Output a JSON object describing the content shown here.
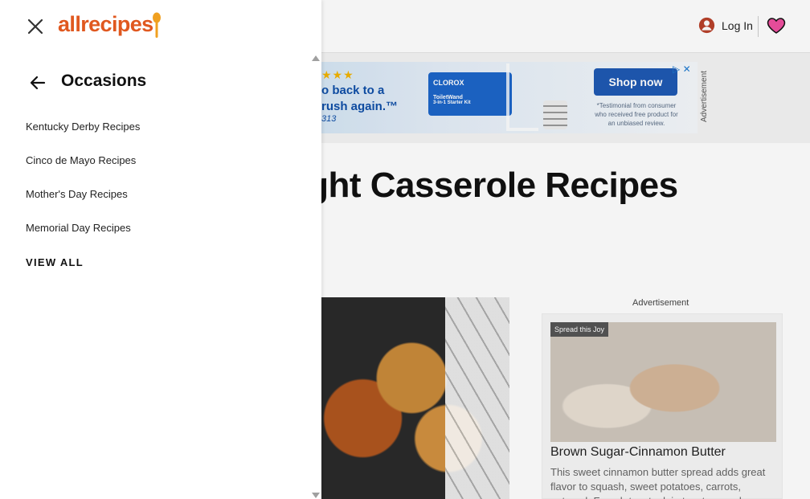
{
  "header": {
    "login_label": "Log In"
  },
  "ad_banner": {
    "stars": "★★★",
    "tagline_line1": "o back to a",
    "tagline_line2": "rush again.™",
    "code": "313",
    "product_brand": "CLOROX",
    "product_name": "ToiletWand",
    "product_sub": "3-in-1 Starter Kit",
    "shop_label": "Shop now",
    "disclaimer": "*Testimonial from consumer who received free product for an unbiased review.",
    "side_label": "Advertisement"
  },
  "main": {
    "heading": "knight Casserole Recipes"
  },
  "sidebar_ad": {
    "label": "Advertisement",
    "badge": "Spread this Joy",
    "title": "Brown Sugar-Cinnamon Butter",
    "description": "This sweet cinnamon butter spread adds great flavor to squash, sweet potatoes, carrots, oatmeal, French toast, plain toast, pancakes"
  },
  "drawer": {
    "logo_text": "allrecipes",
    "section_title": "Occasions",
    "items": [
      {
        "label": "Kentucky Derby Recipes"
      },
      {
        "label": "Cinco de Mayo Recipes"
      },
      {
        "label": "Mother's Day Recipes"
      },
      {
        "label": "Memorial Day Recipes"
      }
    ],
    "view_all_label": "VIEW ALL"
  },
  "colors": {
    "brand": "#e0581f",
    "heart": "#f050a0",
    "ad_button": "#1f59b3"
  },
  "icons": {
    "close": "close-icon",
    "back": "arrow-left-icon",
    "user": "user-circle-icon",
    "heart": "heart-icon",
    "spoon": "spoon-icon"
  }
}
